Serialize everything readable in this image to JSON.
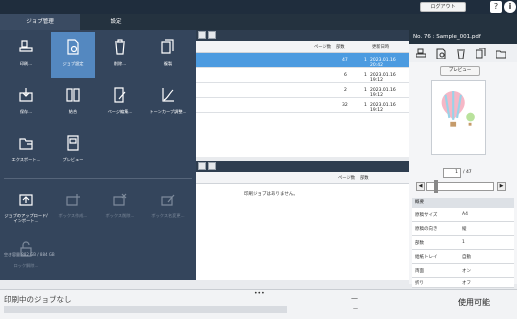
{
  "topbar": {
    "logout_label": "ログアウト",
    "help_icon": "help-icon",
    "info_icon": "info-icon"
  },
  "tabs": {
    "job_management": "ジョブ管理",
    "settings": "設定"
  },
  "menu": {
    "items": [
      {
        "label": "印刷...",
        "icon": "print-icon",
        "enabled": true,
        "selected": false
      },
      {
        "label": "ジョブ設定",
        "icon": "job-settings-icon",
        "enabled": true,
        "selected": true
      },
      {
        "label": "削除...",
        "icon": "trash-icon",
        "enabled": true,
        "selected": false
      },
      {
        "label": "複製",
        "icon": "duplicate-icon",
        "enabled": true,
        "selected": false
      },
      {
        "label": "保存...",
        "icon": "save-icon",
        "enabled": true,
        "selected": false
      },
      {
        "label": "結合",
        "icon": "merge-icon",
        "enabled": true,
        "selected": false
      },
      {
        "label": "ページ編集...",
        "icon": "page-edit-icon",
        "enabled": true,
        "selected": false
      },
      {
        "label": "トーンカーブ調整...",
        "icon": "tone-curve-icon",
        "enabled": true,
        "selected": false
      },
      {
        "label": "エクスポート...",
        "icon": "export-icon",
        "enabled": true,
        "selected": false
      },
      {
        "label": "プレビュー",
        "icon": "preview-icon",
        "enabled": true,
        "selected": false
      },
      {
        "label": "ジョブのアップロード/インポート...",
        "icon": "upload-icon",
        "enabled": true,
        "selected": false
      },
      {
        "label": "ボックス作成...",
        "icon": "box-create-icon",
        "enabled": false,
        "selected": false
      },
      {
        "label": "ボックス削除...",
        "icon": "box-delete-icon",
        "enabled": false,
        "selected": false
      },
      {
        "label": "ボックス名変更...",
        "icon": "box-rename-icon",
        "enabled": false,
        "selected": false
      },
      {
        "label": "ロック解除...",
        "icon": "unlock-icon",
        "enabled": false,
        "selected": false
      }
    ],
    "storage": "空き容量 882 GB / 884 GB"
  },
  "job_list": {
    "columns": {
      "pages": "ページ数",
      "copies": "部数",
      "updated": "更新日時"
    },
    "rows": [
      {
        "pages": "47",
        "copies": "1",
        "updated": "2023.01.16 20:42",
        "selected": true
      },
      {
        "pages": "6",
        "copies": "1",
        "updated": "2023.01.16 19:12",
        "selected": false
      },
      {
        "pages": "2",
        "copies": "1",
        "updated": "2023.01.16 19:12",
        "selected": false
      },
      {
        "pages": "32",
        "copies": "1",
        "updated": "2023.01.16 19:12",
        "selected": false
      }
    ]
  },
  "print_list": {
    "columns": {
      "pages": "ページ数",
      "copies": "部数"
    },
    "empty_message": "印刷ジョブはありません。"
  },
  "preview": {
    "title": "No. 76 : Sample_001.pdf",
    "preview_button": "プレビュー",
    "current_page": "1",
    "total_pages": "/ 47",
    "props_header": "概要",
    "props": [
      {
        "key": "原稿サイズ",
        "value": "A4"
      },
      {
        "key": "原稿の向き",
        "value": "縦"
      },
      {
        "key": "部数",
        "value": "1"
      },
      {
        "key": "給紙トレイ",
        "value": "自動"
      },
      {
        "key": "両面",
        "value": "オン"
      },
      {
        "key": "折り",
        "value": "オフ"
      }
    ]
  },
  "status": {
    "job_text": "印刷中のジョブなし",
    "dash1": "—",
    "dash2": "—",
    "ready": "使用可能",
    "dots": "•••"
  }
}
